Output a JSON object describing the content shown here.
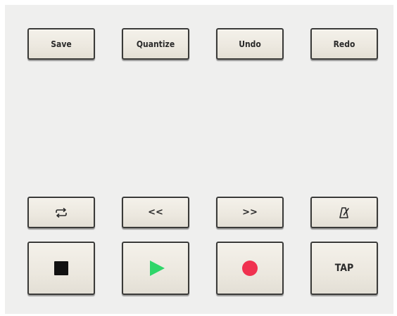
{
  "top_row": {
    "save_label": "Save",
    "quantize_label": "Quantize",
    "undo_label": "Undo",
    "redo_label": "Redo"
  },
  "nav_row": {
    "loop_icon": "loop-icon",
    "rewind_label": "<<",
    "forward_label": ">>",
    "metronome_icon": "metronome-icon"
  },
  "transport_row": {
    "stop_icon": "stop-icon",
    "play_icon": "play-icon",
    "record_icon": "record-icon",
    "tap_label": "TAP"
  },
  "colors": {
    "play": "#2fd66a",
    "record": "#f0314f",
    "stop": "#111111"
  }
}
